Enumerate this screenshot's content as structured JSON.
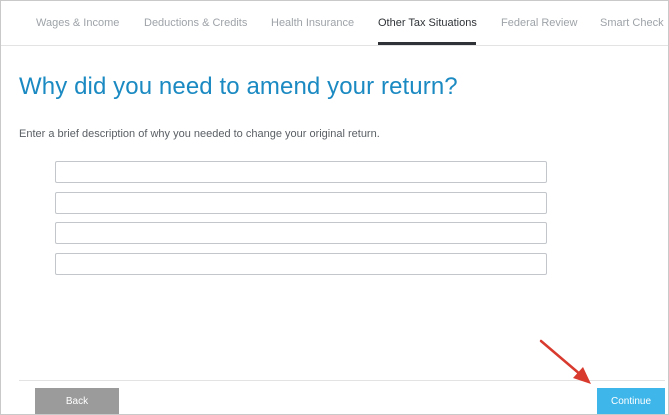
{
  "nav": {
    "tabs": [
      {
        "label": "Wages & Income",
        "active": false
      },
      {
        "label": "Deductions & Credits",
        "active": false
      },
      {
        "label": "Health Insurance",
        "active": false
      },
      {
        "label": "Other Tax Situations",
        "active": true
      },
      {
        "label": "Federal Review",
        "active": false
      },
      {
        "label": "Smart Check",
        "active": false
      }
    ]
  },
  "main": {
    "title": "Why did you need to amend your return?",
    "instruction": "Enter a brief description of why you needed to change your original return.",
    "fields": [
      {
        "value": ""
      },
      {
        "value": ""
      },
      {
        "value": ""
      },
      {
        "value": ""
      }
    ]
  },
  "footer": {
    "back_label": "Back",
    "continue_label": "Continue"
  },
  "colors": {
    "title": "#1b8ac2",
    "continue_button": "#3fb6ea",
    "back_button": "#9b9b9b",
    "annotation_arrow": "#d83a2e"
  },
  "annotation": {
    "icon": "red-arrow-icon"
  }
}
